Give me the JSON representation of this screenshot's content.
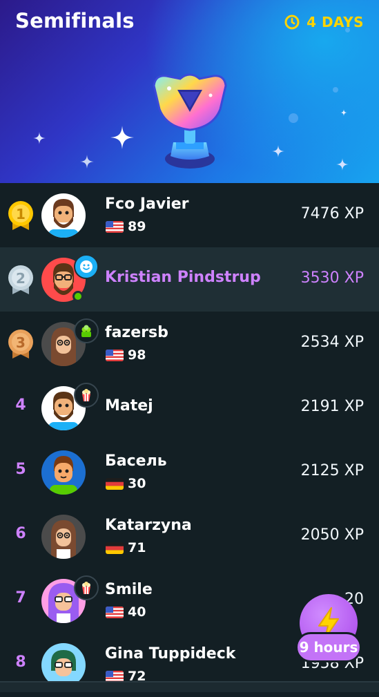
{
  "header": {
    "title": "Semifinals",
    "timer_label": "4 DAYS",
    "timer_icon": "clock-icon",
    "accent_color": "#ffd400"
  },
  "leaderboard": [
    {
      "rank": "1",
      "rank_style": "gold",
      "name": "Fco Javier",
      "country": "us",
      "streak": "89",
      "xp": "7476 XP",
      "highlight": false,
      "frame": null
    },
    {
      "rank": "2",
      "rank_style": "silver",
      "name": "Kristian Pindstrup",
      "country": null,
      "streak": null,
      "xp": "3530 XP",
      "highlight": true,
      "frame": "smiley-icon",
      "online": true
    },
    {
      "rank": "3",
      "rank_style": "bronze",
      "name": "fazersb",
      "country": "us",
      "streak": "98",
      "xp": "2534 XP",
      "highlight": false,
      "frame": "plant-icon"
    },
    {
      "rank": "4",
      "rank_style": "plain",
      "name": "Matej",
      "country": null,
      "streak": null,
      "xp": "2191 XP",
      "highlight": false,
      "frame": "popcorn-icon"
    },
    {
      "rank": "5",
      "rank_style": "plain",
      "name": "Басель",
      "country": "de",
      "streak": "30",
      "xp": "2125 XP",
      "highlight": false,
      "frame": null
    },
    {
      "rank": "6",
      "rank_style": "plain",
      "name": "Katarzyna",
      "country": "de",
      "streak": "71",
      "xp": "2050 XP",
      "highlight": false,
      "frame": null
    },
    {
      "rank": "7",
      "rank_style": "plain",
      "name": "Smile",
      "country": "us",
      "streak": "40",
      "xp": "20",
      "highlight": false,
      "frame": "popcorn-icon"
    },
    {
      "rank": "8",
      "rank_style": "plain",
      "name": "Gina Tuppideck",
      "country": "us",
      "streak": "72",
      "xp": "1958 XP",
      "highlight": false,
      "frame": null
    }
  ],
  "boost": {
    "label": "9 hours",
    "icon": "lightning-icon"
  },
  "colors": {
    "background": "#131f24",
    "highlight_row": "#1f2f35",
    "highlight_text": "#ce82ff",
    "gold": "#ffc800",
    "silver": "#c5d6df",
    "bronze": "#e9a15b"
  }
}
